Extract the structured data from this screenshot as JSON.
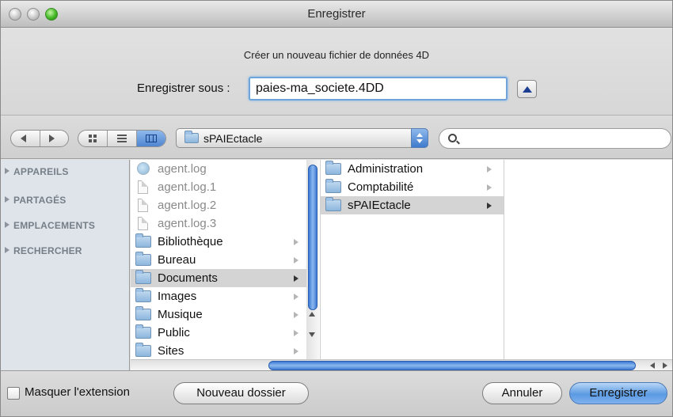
{
  "window": {
    "title": "Enregistrer"
  },
  "save": {
    "message": "Créer un nouveau fichier de données 4D",
    "label": "Enregistrer sous :",
    "filename": "paies-ma_societe.4DD"
  },
  "toolbar": {
    "current_folder": "sPAIEctacle",
    "search_placeholder": ""
  },
  "sidebar": {
    "sections": [
      {
        "label": "APPAREILS"
      },
      {
        "label": "PARTAGÉS"
      },
      {
        "label": "EMPLACEMENTS"
      },
      {
        "label": "RECHERCHER"
      }
    ]
  },
  "columns": {
    "col1": [
      {
        "label": "agent.log",
        "type": "log",
        "dim": true
      },
      {
        "label": "agent.log.1",
        "type": "doc",
        "dim": true
      },
      {
        "label": "agent.log.2",
        "type": "doc",
        "dim": true
      },
      {
        "label": "agent.log.3",
        "type": "doc",
        "dim": true
      },
      {
        "label": "Bibliothèque",
        "type": "folder"
      },
      {
        "label": "Bureau",
        "type": "folder"
      },
      {
        "label": "Documents",
        "type": "folder",
        "selected": true
      },
      {
        "label": "Images",
        "type": "folder"
      },
      {
        "label": "Musique",
        "type": "folder"
      },
      {
        "label": "Public",
        "type": "folder"
      },
      {
        "label": "Sites",
        "type": "folder"
      }
    ],
    "col2": [
      {
        "label": "Administration",
        "type": "folder"
      },
      {
        "label": "Comptabilité",
        "type": "folder"
      },
      {
        "label": "sPAIEctacle",
        "type": "folder",
        "selected": true
      }
    ],
    "col3": []
  },
  "bottom": {
    "hide_extension": "Masquer l'extension",
    "hide_extension_checked": false,
    "new_folder": "Nouveau dossier",
    "cancel": "Annuler",
    "save": "Enregistrer"
  },
  "icons": [
    "close-light-icon",
    "minimize-light-icon",
    "zoom-light-icon",
    "back-arrow-icon",
    "forward-arrow-icon",
    "icon-view-icon",
    "list-view-icon",
    "column-view-icon",
    "folder-icon",
    "search-icon",
    "document-icon",
    "chevron-right-icon"
  ],
  "colors": {
    "accent": "#4f86d1",
    "selection": "#d4d4d4",
    "sidebar": "#dfe4ea"
  }
}
